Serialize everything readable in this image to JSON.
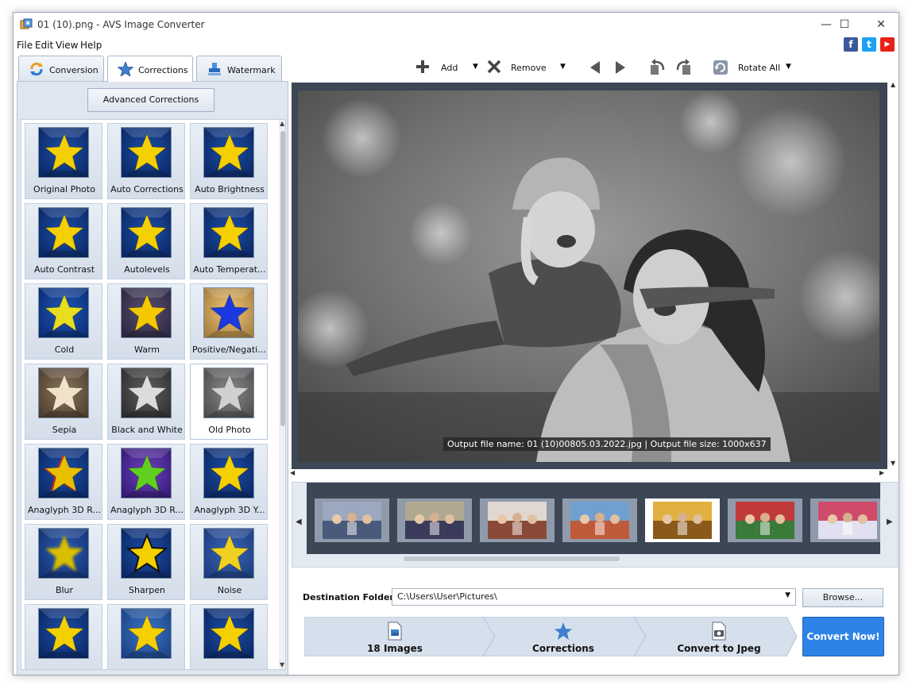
{
  "window": {
    "title": "01 (10).png - AVS Image Converter"
  },
  "window_controls": {
    "minimize": "—",
    "maximize": "☐",
    "close": "✕"
  },
  "menu": [
    "File",
    "Edit",
    "View",
    "Help"
  ],
  "social": {
    "facebook": "f",
    "twitter": "t",
    "youtube": "▶"
  },
  "tabs": [
    {
      "label": "Conversion",
      "icon": "refresh-icon"
    },
    {
      "label": "Corrections",
      "icon": "star-icon",
      "active": true
    },
    {
      "label": "Watermark",
      "icon": "stamp-icon"
    }
  ],
  "left_panel": {
    "advanced_button": "Advanced Corrections",
    "effects": [
      {
        "label": "Original Photo",
        "style": "blue"
      },
      {
        "label": "Auto Corrections",
        "style": "blue"
      },
      {
        "label": "Auto Brightness",
        "style": "blue"
      },
      {
        "label": "Auto Contrast",
        "style": "blue"
      },
      {
        "label": "Autolevels",
        "style": "blue"
      },
      {
        "label": "Auto Temperat...",
        "style": "blue"
      },
      {
        "label": "Cold",
        "style": "cold"
      },
      {
        "label": "Warm",
        "style": "warm"
      },
      {
        "label": "Positive/Negative",
        "style": "negative"
      },
      {
        "label": "Sepia",
        "style": "sepia"
      },
      {
        "label": "Black and White",
        "style": "bw"
      },
      {
        "label": "Old Photo",
        "style": "old",
        "selected": true
      },
      {
        "label": "Anaglyph 3D R...",
        "style": "anaglyph1"
      },
      {
        "label": "Anaglyph 3D R...",
        "style": "anaglyph2"
      },
      {
        "label": "Anaglyph 3D Y...",
        "style": "blue"
      },
      {
        "label": "Blur",
        "style": "blur"
      },
      {
        "label": "Sharpen",
        "style": "sharpen"
      },
      {
        "label": "Noise",
        "style": "noise"
      },
      {
        "label": "",
        "style": "blue"
      },
      {
        "label": "",
        "style": "blue2"
      },
      {
        "label": "",
        "style": "blue"
      }
    ]
  },
  "toolbar": {
    "add": "Add",
    "remove": "Remove",
    "rotate_all": "Rotate All"
  },
  "preview": {
    "caption": "Output file name: 01 (10)00805.03.2022.jpg | Output file size: 1000x637"
  },
  "filmstrip": {
    "items": [
      {
        "name": "thumb-group-crowd",
        "selected": false
      },
      {
        "name": "thumb-graduation",
        "selected": false
      },
      {
        "name": "thumb-office-meeting",
        "selected": false
      },
      {
        "name": "thumb-kids-smiling",
        "selected": false
      },
      {
        "name": "thumb-mother-child",
        "selected": true
      },
      {
        "name": "thumb-kids-running",
        "selected": false
      },
      {
        "name": "thumb-party",
        "selected": false
      }
    ]
  },
  "destination": {
    "label": "Destination Folder:",
    "path": "C:\\Users\\User\\Pictures\\",
    "browse": "Browse..."
  },
  "steps": [
    {
      "label": "18 Images",
      "icon": "image-file-icon"
    },
    {
      "label": "Corrections",
      "icon": "star-icon"
    },
    {
      "label": "Convert to Jpeg",
      "icon": "camera-file-icon"
    }
  ],
  "convert_button": "Convert Now!",
  "colors": {
    "accent": "#2d84e6",
    "panel": "#dfe6ef",
    "preview_bg": "#3c4655",
    "star": "#f5d000"
  }
}
